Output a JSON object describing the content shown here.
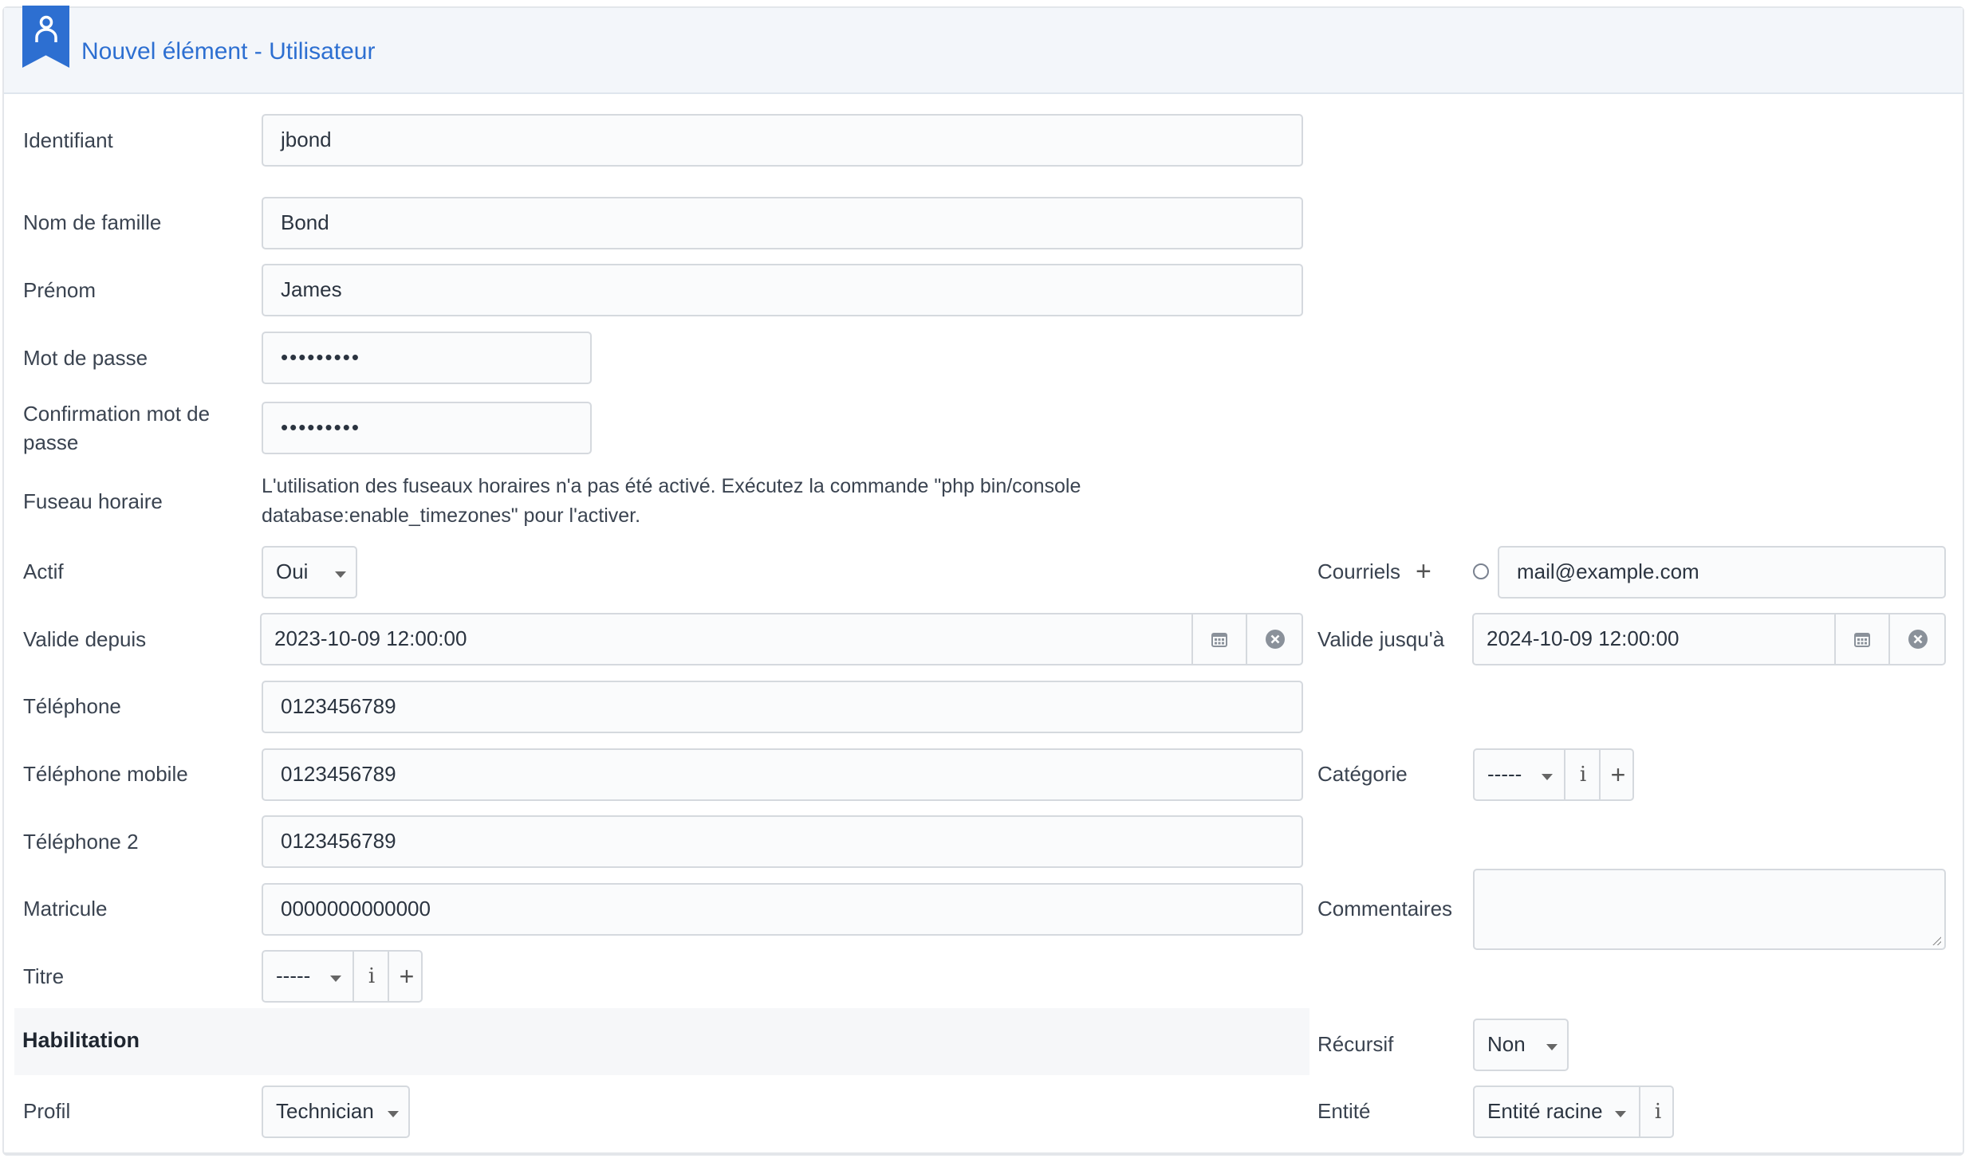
{
  "header": {
    "title": "Nouvel élément - Utilisateur",
    "icon": "user-bookmark-icon",
    "accent_color": "#2d6fd1"
  },
  "fields": {
    "identifiant": {
      "label": "Identifiant",
      "value": "jbond"
    },
    "nom": {
      "label": "Nom de famille",
      "value": "Bond"
    },
    "prenom": {
      "label": "Prénom",
      "value": "James"
    },
    "mot_de_passe": {
      "label": "Mot de passe",
      "value": "•••••••••"
    },
    "confirmation": {
      "label": "Confirmation mot de passe",
      "value": "•••••••••"
    },
    "fuseau": {
      "label": "Fuseau horaire",
      "note": "L'utilisation des fuseaux horaires n'a pas été activé. Exécutez la commande \"php bin/console database:enable_timezones\" pour l'activer."
    },
    "actif": {
      "label": "Actif",
      "value": "Oui"
    },
    "valide_depuis": {
      "label": "Valide depuis",
      "value": "2023-10-09 12:00:00"
    },
    "telephone": {
      "label": "Téléphone",
      "value": "0123456789"
    },
    "telephone_mobile": {
      "label": "Téléphone mobile",
      "value": "0123456789"
    },
    "telephone_2": {
      "label": "Téléphone 2",
      "value": "0123456789"
    },
    "matricule": {
      "label": "Matricule",
      "value": "0000000000000"
    },
    "titre": {
      "label": "Titre",
      "value": "-----"
    },
    "courriels": {
      "label": "Courriels",
      "value": "mail@example.com"
    },
    "valide_jusqua": {
      "label": "Valide jusqu'à",
      "value": "2024-10-09 12:00:00"
    },
    "categorie": {
      "label": "Catégorie",
      "value": "-----"
    },
    "commentaires": {
      "label": "Commentaires",
      "value": ""
    }
  },
  "habilitation": {
    "title": "Habilitation",
    "recursif": {
      "label": "Récursif",
      "value": "Non"
    },
    "profil": {
      "label": "Profil",
      "value": "Technician"
    },
    "entite": {
      "label": "Entité",
      "value": "Entité racine"
    }
  },
  "icons": {
    "calendar": "calendar-icon",
    "clear": "clear-circle-icon",
    "info": "i",
    "add": "+"
  }
}
